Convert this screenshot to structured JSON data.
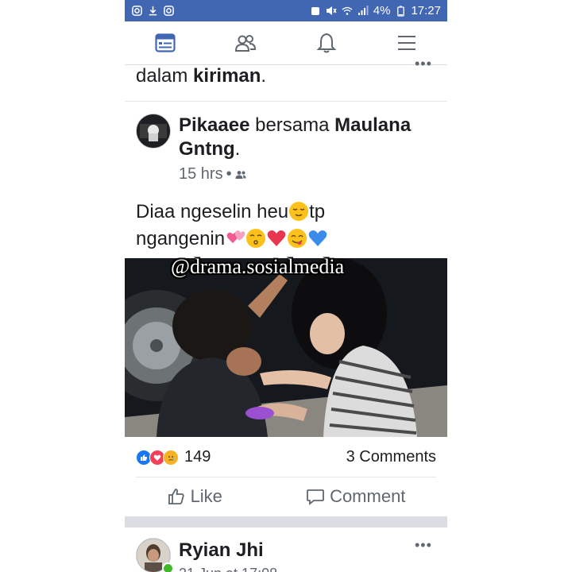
{
  "status_bar": {
    "left_icons": [
      "instagram-icon",
      "download-icon",
      "instagram-icon"
    ],
    "battery": "4%",
    "time": "17:27"
  },
  "nav": {
    "items": [
      "news-feed-icon",
      "friends-icon",
      "notifications-icon",
      "menu-icon"
    ],
    "active_color": "#4267b2",
    "inactive_color": "#606770"
  },
  "previous_post": {
    "tail_text": "dalam ",
    "tail_bold": "kiriman",
    "tail_end": "."
  },
  "post": {
    "author": "Pikaaee",
    "with_word": "bersama",
    "tagged": "Maulana Gntng",
    "tagged_end": ".",
    "time": "15 hrs",
    "audience_icon": "friends-icon",
    "text_line1": "Diaa ngeselin heu",
    "text_line1_end": "tp",
    "text_line2": "ngangenin",
    "emojis_line1": [
      "relieved-face"
    ],
    "emojis_line2": [
      "heart-with-ribbon",
      "kissing-face",
      "red-heart",
      "yum-face",
      "blue-heart"
    ],
    "reaction_icons": [
      "like-icon",
      "love-icon",
      "sad-icon"
    ],
    "reaction_count": "149",
    "comments_count": "3 Comments",
    "like_label": "Like",
    "comment_label": "Comment"
  },
  "watermark": "@drama.sosialmedia",
  "next_post": {
    "author": "Ryian Jhi",
    "meta": "21 Jun at 17:08"
  },
  "colors": {
    "brand": "#4267b2",
    "like_blue": "#1877f2",
    "love_red": "#f33e58",
    "sad_yellow": "#f7b125"
  }
}
